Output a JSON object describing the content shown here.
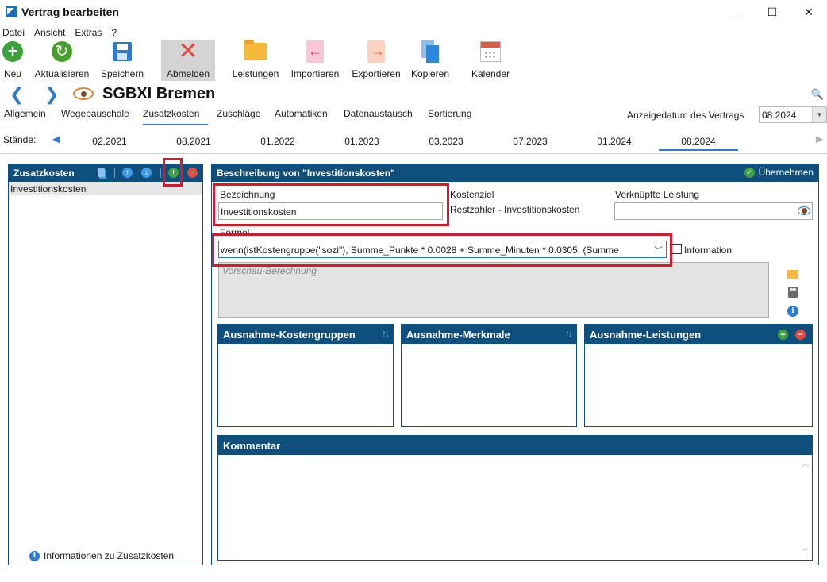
{
  "window": {
    "title": "Vertrag bearbeiten",
    "controls": {
      "minimize": "—",
      "maximize": "☐",
      "close": "✕"
    }
  },
  "menu": [
    "Datei",
    "Ansicht",
    "Extras",
    "?"
  ],
  "toolbar": {
    "items": [
      {
        "label": "Neu",
        "icon": "plus-circle-icon"
      },
      {
        "label": "Aktualisieren",
        "icon": "refresh-icon"
      },
      {
        "label": "Speichern",
        "icon": "save-icon"
      },
      {
        "label": "Abmelden",
        "icon": "close-x-icon",
        "pressed": true
      },
      {
        "label": "Leistungen",
        "icon": "folder-icon"
      },
      {
        "label": "Importieren",
        "icon": "import-icon"
      },
      {
        "label": "Exportieren",
        "icon": "export-icon"
      },
      {
        "label": "Kopieren",
        "icon": "copy-icon"
      },
      {
        "label": "Kalender",
        "icon": "calendar-icon"
      }
    ]
  },
  "record": {
    "title": "SGBXI Bremen",
    "prev": "❮",
    "next": "❯"
  },
  "tabs": [
    "Allgemein",
    "Wegepauschale",
    "Zusatzkosten",
    "Zuschläge",
    "Automatiken",
    "Datenaustausch",
    "Sortierung"
  ],
  "active_tab": "Zusatzkosten",
  "display_date": {
    "label": "Anzeigedatum des Vertrags",
    "value": "08.2024"
  },
  "staende": {
    "label": "Stände:",
    "dates": [
      "02.2021",
      "08.2021",
      "01.2022",
      "01.2023",
      "03.2023",
      "07.2023",
      "01.2024",
      "08.2024"
    ],
    "active": "08.2024"
  },
  "left_panel": {
    "title": "Zusatzkosten",
    "items": [
      "Investitionskosten"
    ],
    "footer": "Informationen zu Zusatzkosten"
  },
  "right_panel": {
    "title": "Beschreibung von \"Investitionskosten\"",
    "apply_label": "Übernehmen",
    "bezeichnung_label": "Bezeichnung",
    "bezeichnung_value": "Investitionskosten",
    "kostenziel_label": "Kostenziel",
    "kostenziel_value": "Restzahler - Investitionskosten",
    "verknuepfte_label": "Verknüpfte Leistung",
    "verknuepfte_value": "",
    "formel_label": "Formel",
    "formel_value": "wenn(istKostengruppe(\"sozi\"), Summe_Punkte * 0.0028 + Summe_Minuten * 0.0305, (Summe",
    "information_label": "Information",
    "preview_placeholder": "Vorschau-Berechnung",
    "sub_boxes": [
      "Ausnahme-Kostengruppen",
      "Ausnahme-Merkmale",
      "Ausnahme-Leistungen"
    ],
    "comment_title": "Kommentar"
  },
  "colors": {
    "header_blue": "#0f4f7e",
    "accent_blue": "#2b7bd0",
    "highlight_red": "#d8192b",
    "add_green": "#3da23d",
    "remove_red": "#e04b3c"
  }
}
